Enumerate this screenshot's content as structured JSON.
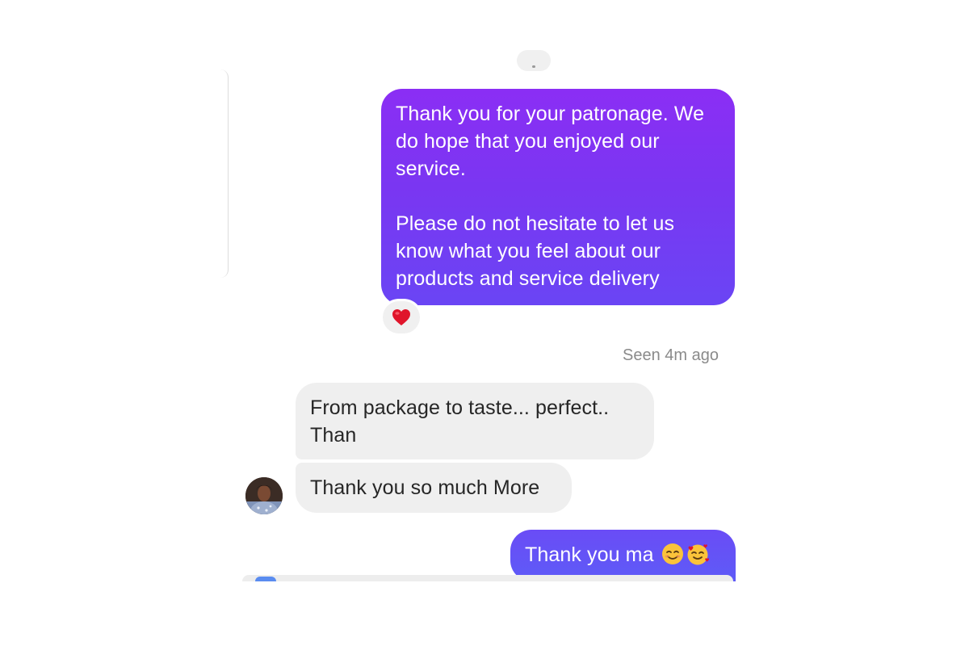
{
  "messages": {
    "outgoing_1": {
      "paragraph_1": "Thank you for your patronage. We do hope that you enjoyed our service.",
      "paragraph_2": "Please do not hesitate to let us know what you feel about our products and service delivery",
      "reaction_icon": "red-heart"
    },
    "seen_status": "Seen 4m ago",
    "incoming_1": "From package to taste... perfect.. Than",
    "incoming_2": "Thank you so much More",
    "outgoing_2": {
      "text": "Thank you ma ",
      "emojis": [
        "smiling-face-icon",
        "smiling-face-with-hearts-icon"
      ]
    }
  },
  "colors": {
    "outgoing_gradient_top": "#8b2ef4",
    "outgoing_gradient_bottom": "#6a45f4",
    "incoming_bubble": "#efefef",
    "seen_text": "#8a8a8a",
    "heart": "#e0152b"
  }
}
